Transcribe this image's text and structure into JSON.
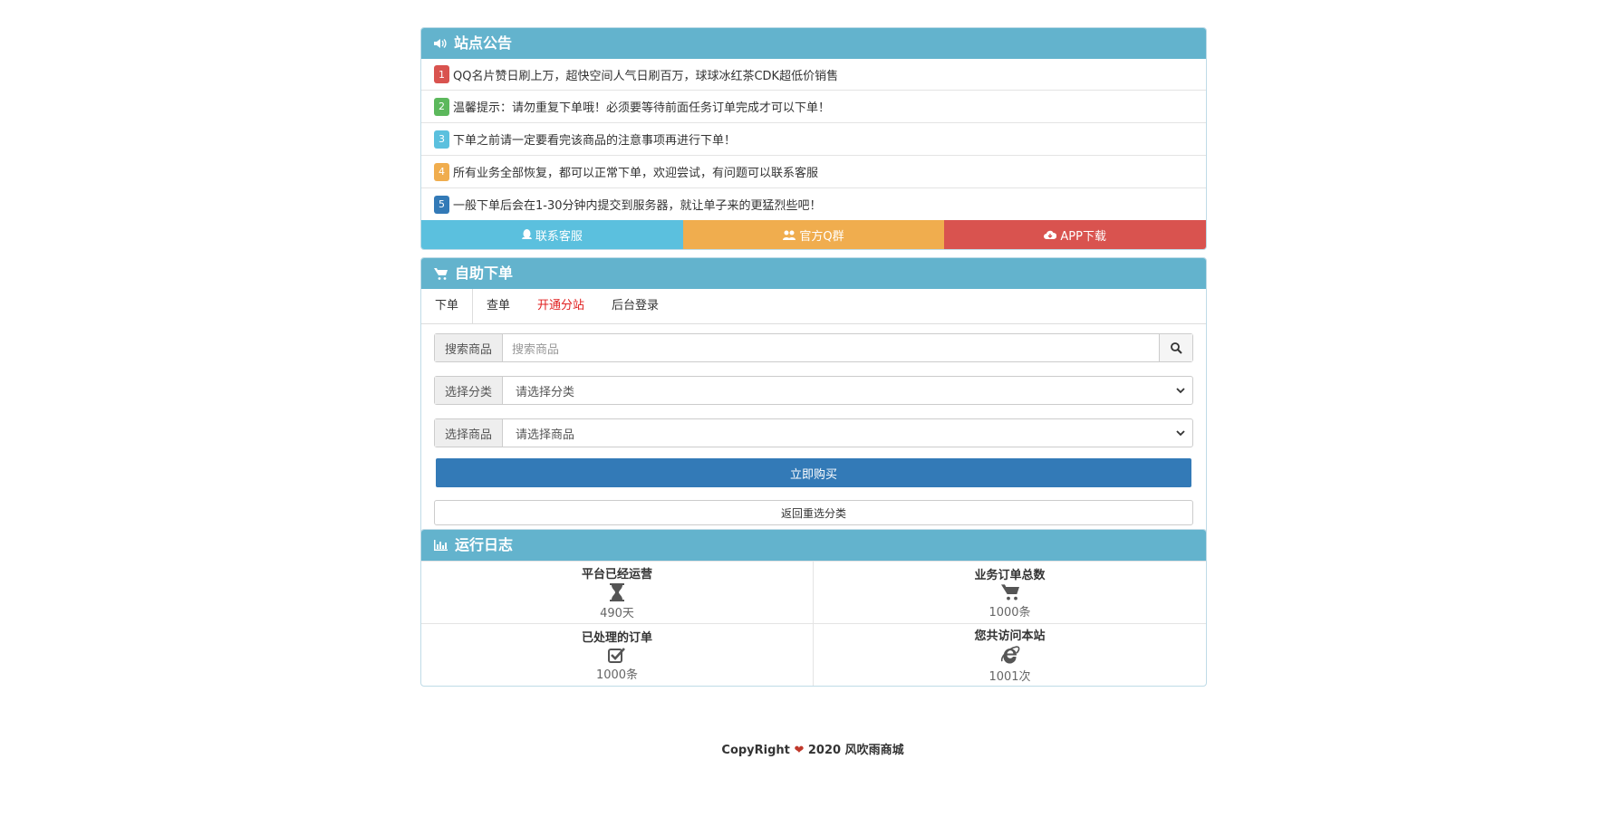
{
  "notice": {
    "title": "站点公告",
    "items": [
      {
        "num": "1",
        "text": "QQ名片赞日刷上万，超快空间人气日刷百万，球球冰红茶CDK超低价销售",
        "color": "#d9534f"
      },
      {
        "num": "2",
        "text": "温馨提示：请勿重复下单哦！必须要等待前面任务订单完成才可以下单！",
        "color": "#5cb85c"
      },
      {
        "num": "3",
        "text": "下单之前请一定要看完该商品的注意事项再进行下单！",
        "color": "#5bc0de"
      },
      {
        "num": "4",
        "text": "所有业务全部恢复，都可以正常下单，欢迎尝试，有问题可以联系客服",
        "color": "#f0ad4e"
      },
      {
        "num": "5",
        "text": "一般下单后会在1-30分钟内提交到服务器，就让单子来的更猛烈些吧！",
        "color": "#337ab7"
      }
    ],
    "buttons": [
      {
        "label": "联系客服",
        "icon": "qq-icon",
        "color": "#5bc0de"
      },
      {
        "label": "官方Q群",
        "icon": "users-icon",
        "color": "#f0ad4e"
      },
      {
        "label": "APP下载",
        "icon": "cloud-download-icon",
        "color": "#d9534f"
      }
    ]
  },
  "order": {
    "title": "自助下单",
    "tabs": [
      "下单",
      "查单",
      "开通分站",
      "后台登录"
    ],
    "search_label": "搜索商品",
    "search_placeholder": "搜索商品",
    "category_label": "选择分类",
    "category_value": "请选择分类",
    "product_label": "选择商品",
    "product_value": "请选择商品",
    "buy_label": "立即购买",
    "back_label": "返回重选分类"
  },
  "log": {
    "title": "运行日志",
    "stats": [
      {
        "label": "平台已经运营",
        "value": "490天",
        "icon": "hourglass-icon"
      },
      {
        "label": "业务订单总数",
        "value": "1000条",
        "icon": "cart-icon"
      },
      {
        "label": "已处理的订单",
        "value": "1000条",
        "icon": "check-square-icon"
      },
      {
        "label": "您共访问本站",
        "value": "1001次",
        "icon": "ie-icon"
      }
    ]
  },
  "footer": {
    "prefix": "CopyRight",
    "suffix": "2020 风吹雨商城"
  }
}
